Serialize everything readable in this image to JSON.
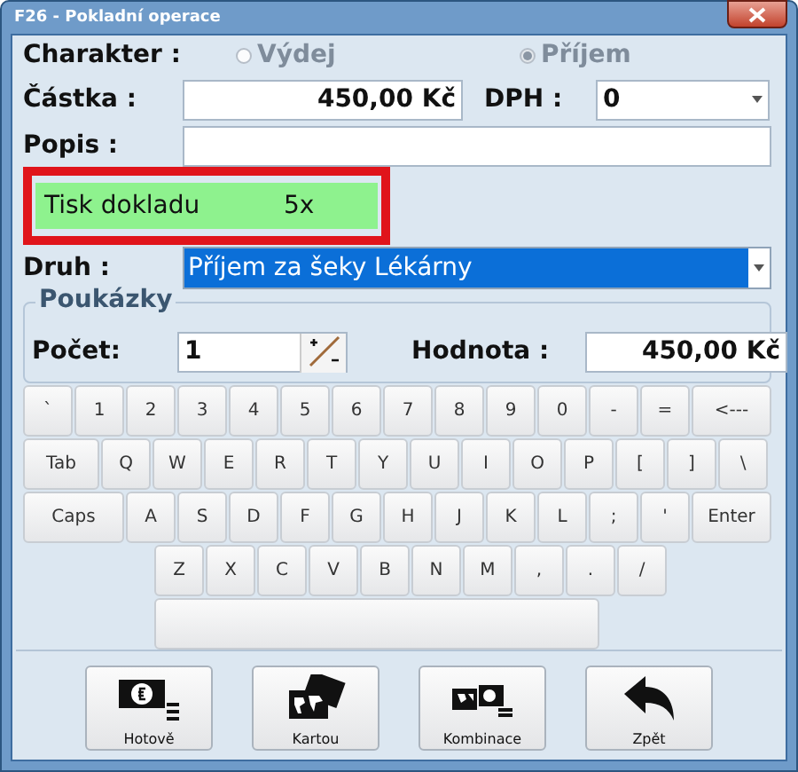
{
  "window": {
    "title": "F26 - Pokladní operace"
  },
  "charakter": {
    "label": "Charakter :",
    "options": [
      {
        "label": "Výdej",
        "selected": false,
        "disabled": true
      },
      {
        "label": "Příjem",
        "selected": true,
        "disabled": true
      }
    ]
  },
  "castka": {
    "label": "Částka :",
    "value": "450,00 Kč"
  },
  "dph": {
    "label": "DPH :",
    "value": "0"
  },
  "popis": {
    "label": "Popis :"
  },
  "tisk": {
    "label": "Tisk dokladu",
    "count": "5x"
  },
  "druh": {
    "label": "Druh :",
    "value": "Příjem za šeky Lékárny",
    "selected": true
  },
  "poukazky": {
    "title": "Poukázky",
    "pocet_label": "Počet:",
    "pocet_value": "1",
    "hodnota_label": "Hodnota :",
    "hodnota_value": "450,00 Kč"
  },
  "keyboard": [
    {
      "kind": "full",
      "keys": [
        {
          "label": "`",
          "kind": "char"
        },
        {
          "label": "1",
          "kind": "char"
        },
        {
          "label": "2",
          "kind": "char"
        },
        {
          "label": "3",
          "kind": "char"
        },
        {
          "label": "4",
          "kind": "char"
        },
        {
          "label": "5",
          "kind": "char"
        },
        {
          "label": "6",
          "kind": "char"
        },
        {
          "label": "7",
          "kind": "char"
        },
        {
          "label": "8",
          "kind": "char"
        },
        {
          "label": "9",
          "kind": "char"
        },
        {
          "label": "0",
          "kind": "char"
        },
        {
          "label": "-",
          "kind": "char"
        },
        {
          "label": "=",
          "kind": "char"
        },
        {
          "label": "<---",
          "kind": "backspace"
        }
      ]
    },
    {
      "kind": "full",
      "keys": [
        {
          "label": "Tab",
          "kind": "tab"
        },
        {
          "label": "Q",
          "kind": "char"
        },
        {
          "label": "W",
          "kind": "char"
        },
        {
          "label": "E",
          "kind": "char"
        },
        {
          "label": "R",
          "kind": "char"
        },
        {
          "label": "T",
          "kind": "char"
        },
        {
          "label": "Y",
          "kind": "char"
        },
        {
          "label": "U",
          "kind": "char"
        },
        {
          "label": "I",
          "kind": "char"
        },
        {
          "label": "O",
          "kind": "char"
        },
        {
          "label": "P",
          "kind": "char"
        },
        {
          "label": "[",
          "kind": "char"
        },
        {
          "label": "]",
          "kind": "char"
        },
        {
          "label": "\\",
          "kind": "char"
        }
      ]
    },
    {
      "kind": "full",
      "keys": [
        {
          "label": "Caps",
          "kind": "caps"
        },
        {
          "label": "A",
          "kind": "char"
        },
        {
          "label": "S",
          "kind": "char"
        },
        {
          "label": "D",
          "kind": "char"
        },
        {
          "label": "F",
          "kind": "char"
        },
        {
          "label": "G",
          "kind": "char"
        },
        {
          "label": "H",
          "kind": "char"
        },
        {
          "label": "J",
          "kind": "char"
        },
        {
          "label": "K",
          "kind": "char"
        },
        {
          "label": "L",
          "kind": "char"
        },
        {
          "label": ";",
          "kind": "char"
        },
        {
          "label": "'",
          "kind": "char"
        },
        {
          "label": "Enter",
          "kind": "enter"
        }
      ]
    },
    {
      "kind": "indented",
      "keys": [
        {
          "label": "Z",
          "kind": "char"
        },
        {
          "label": "X",
          "kind": "char"
        },
        {
          "label": "C",
          "kind": "char"
        },
        {
          "label": "V",
          "kind": "char"
        },
        {
          "label": "B",
          "kind": "char"
        },
        {
          "label": "N",
          "kind": "char"
        },
        {
          "label": "M",
          "kind": "char"
        },
        {
          "label": ",",
          "kind": "char"
        },
        {
          "label": ".",
          "kind": "char"
        },
        {
          "label": "/",
          "kind": "char"
        }
      ]
    },
    {
      "kind": "indented",
      "keys": [
        {
          "kind": "space"
        }
      ]
    }
  ],
  "buttons": [
    {
      "label": "Hotově",
      "kind": "cash"
    },
    {
      "label": "Kartou",
      "kind": "card"
    },
    {
      "label": "Kombinace",
      "kind": "combo"
    },
    {
      "label": "Zpět",
      "kind": "back"
    }
  ]
}
